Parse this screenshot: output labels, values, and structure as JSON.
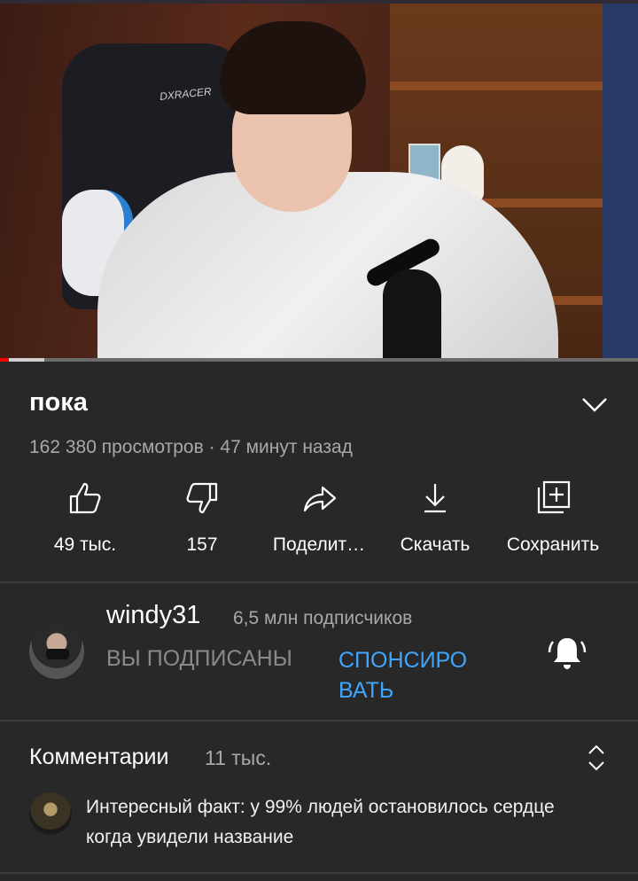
{
  "video": {
    "chair_logo": "DXRACER",
    "progress_played": 0.014,
    "progress_buffered": 0.07
  },
  "title": "пока",
  "stats": "162 380 просмотров · 47 минут назад",
  "actions": [
    {
      "icon": "like-icon",
      "label": "49 тыс."
    },
    {
      "icon": "dislike-icon",
      "label": "157"
    },
    {
      "icon": "share-icon",
      "label": "Поделит…"
    },
    {
      "icon": "download-icon",
      "label": "Скачать"
    },
    {
      "icon": "save-to-playlist-icon",
      "label": "Сохранить"
    }
  ],
  "channel": {
    "name": "windy31",
    "subscribers": "6,5 млн подписчиков",
    "subscribed_label": "ВЫ ПОДПИСАНЫ",
    "sponsor_label": "СПОНСИРО ВАТЬ"
  },
  "comments": {
    "title": "Комментарии",
    "count": "11 тыс.",
    "top_comment": "Интересный факт: у 99% людей остановилось сердце когда увидели название"
  },
  "colors": {
    "background": "#282828",
    "accent_blue": "#3ea6ff",
    "progress_red": "#ff0000",
    "secondary_text": "#a8a8a8"
  }
}
